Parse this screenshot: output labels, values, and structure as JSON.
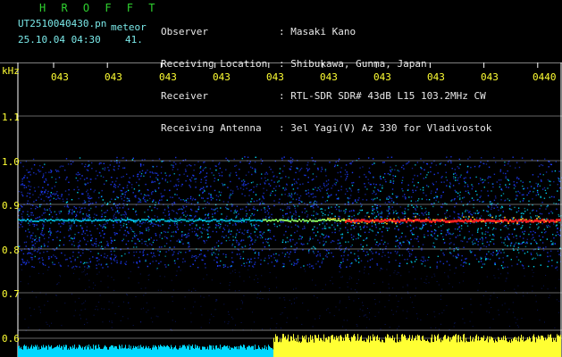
{
  "station": {
    "callsign": "H R O F F T",
    "filename": "UT2510040430.pn",
    "mode": "meteor",
    "date_time": "25.10.04 04:30",
    "count": "41."
  },
  "info": {
    "labels": [
      "Observer",
      "Receiving Location",
      "Receiver",
      "Receiving Antenna"
    ],
    "values": [
      ": Masaki Kano",
      ": Shibukawa, Gunma, Japan",
      ": RTL-SDR SDR# 43dB L15 103.2MHz CW",
      ": 3el Yagi(V) Az 330 for Vladivostok"
    ]
  },
  "plot": {
    "y_unit": "kHz",
    "y_ticks": [
      "1.1",
      "1.0",
      "0.9",
      "0.8",
      "0.7",
      "0.6"
    ],
    "x_ticks": [
      "043",
      "043",
      "043",
      "043",
      "043",
      "043",
      "043",
      "043",
      "043",
      "0440"
    ],
    "colors": {
      "grid": "#ffffff",
      "axis_text": "#ffff33",
      "noise_low": "#1e3cff",
      "noise_high": "#00e0ff",
      "signal": "#ff2020",
      "bottom_level_left": "#00d8ff",
      "bottom_level_right": "#ffff33"
    }
  }
}
